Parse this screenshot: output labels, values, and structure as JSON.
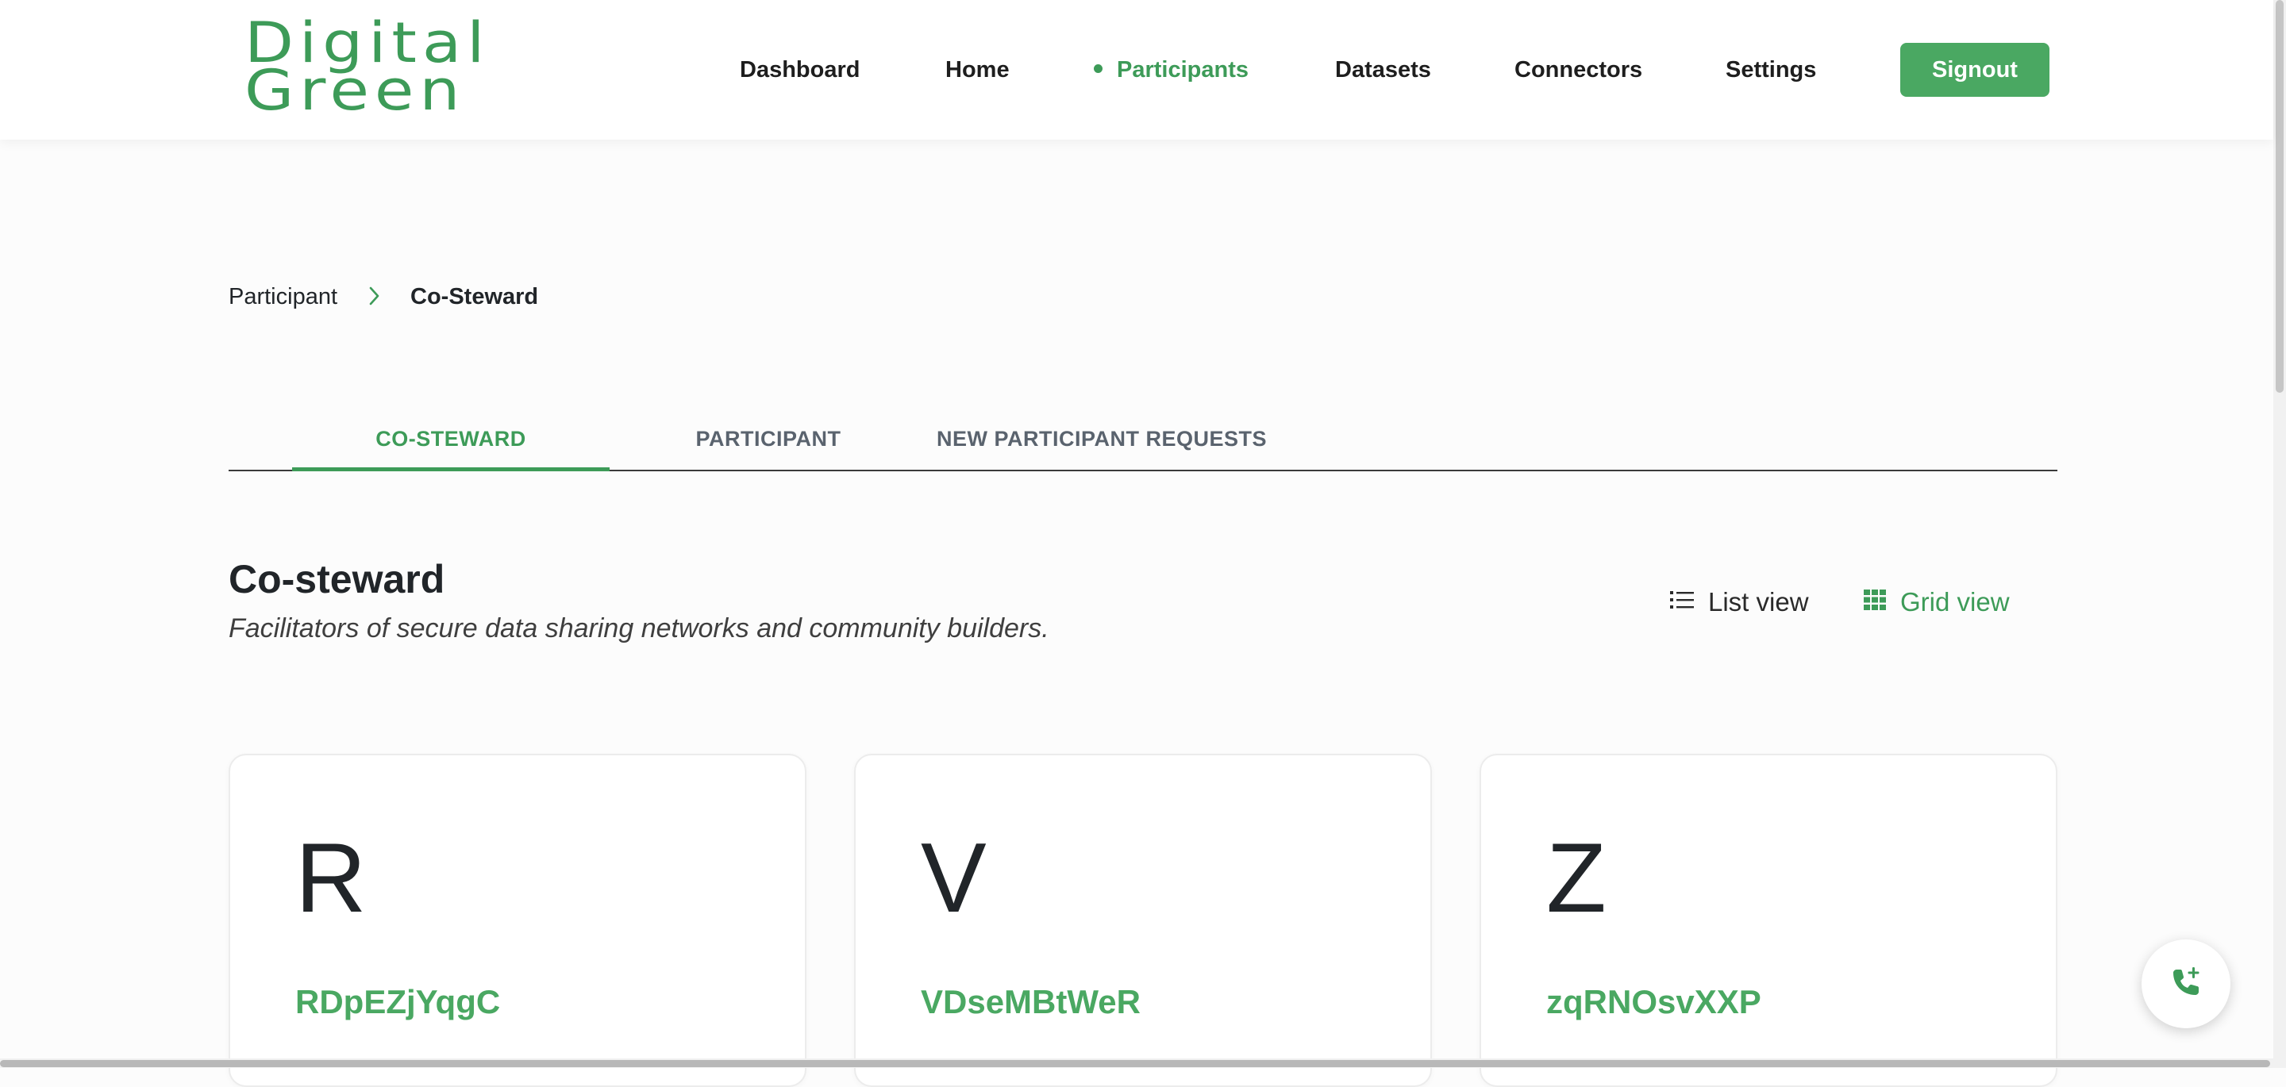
{
  "brand": {
    "line1": "Digital",
    "line2": "Green",
    "color": "#3d9b58"
  },
  "nav": {
    "items": [
      {
        "label": "Dashboard",
        "active": false
      },
      {
        "label": "Home",
        "active": false
      },
      {
        "label": "Participants",
        "active": true
      },
      {
        "label": "Datasets",
        "active": false
      },
      {
        "label": "Connectors",
        "active": false
      },
      {
        "label": "Settings",
        "active": false
      }
    ],
    "signout_label": "Signout"
  },
  "breadcrumb": {
    "parent": "Participant",
    "separator_icon": "chevron-right-icon",
    "current": "Co-Steward"
  },
  "tabs": [
    {
      "label": "CO-STEWARD",
      "active": true
    },
    {
      "label": "PARTICIPANT",
      "active": false
    },
    {
      "label": "NEW PARTICIPANT REQUESTS",
      "active": false
    }
  ],
  "section": {
    "title": "Co-steward",
    "subtitle": "Facilitators of secure data sharing networks and community builders."
  },
  "view_toggle": {
    "list_label": "List view",
    "list_icon": "list-icon",
    "grid_label": "Grid view",
    "grid_icon": "grid-icon",
    "active": "grid"
  },
  "cards": [
    {
      "initial": "R",
      "name": "RDpEZjYqgC"
    },
    {
      "initial": "V",
      "name": "VDseMBtWeR"
    },
    {
      "initial": "Z",
      "name": "zqRNOsvXXP"
    }
  ],
  "fab": {
    "icon": "phone-add-icon"
  },
  "colors": {
    "accent": "#3d9b58",
    "button": "#4aa862",
    "text": "#212529"
  }
}
